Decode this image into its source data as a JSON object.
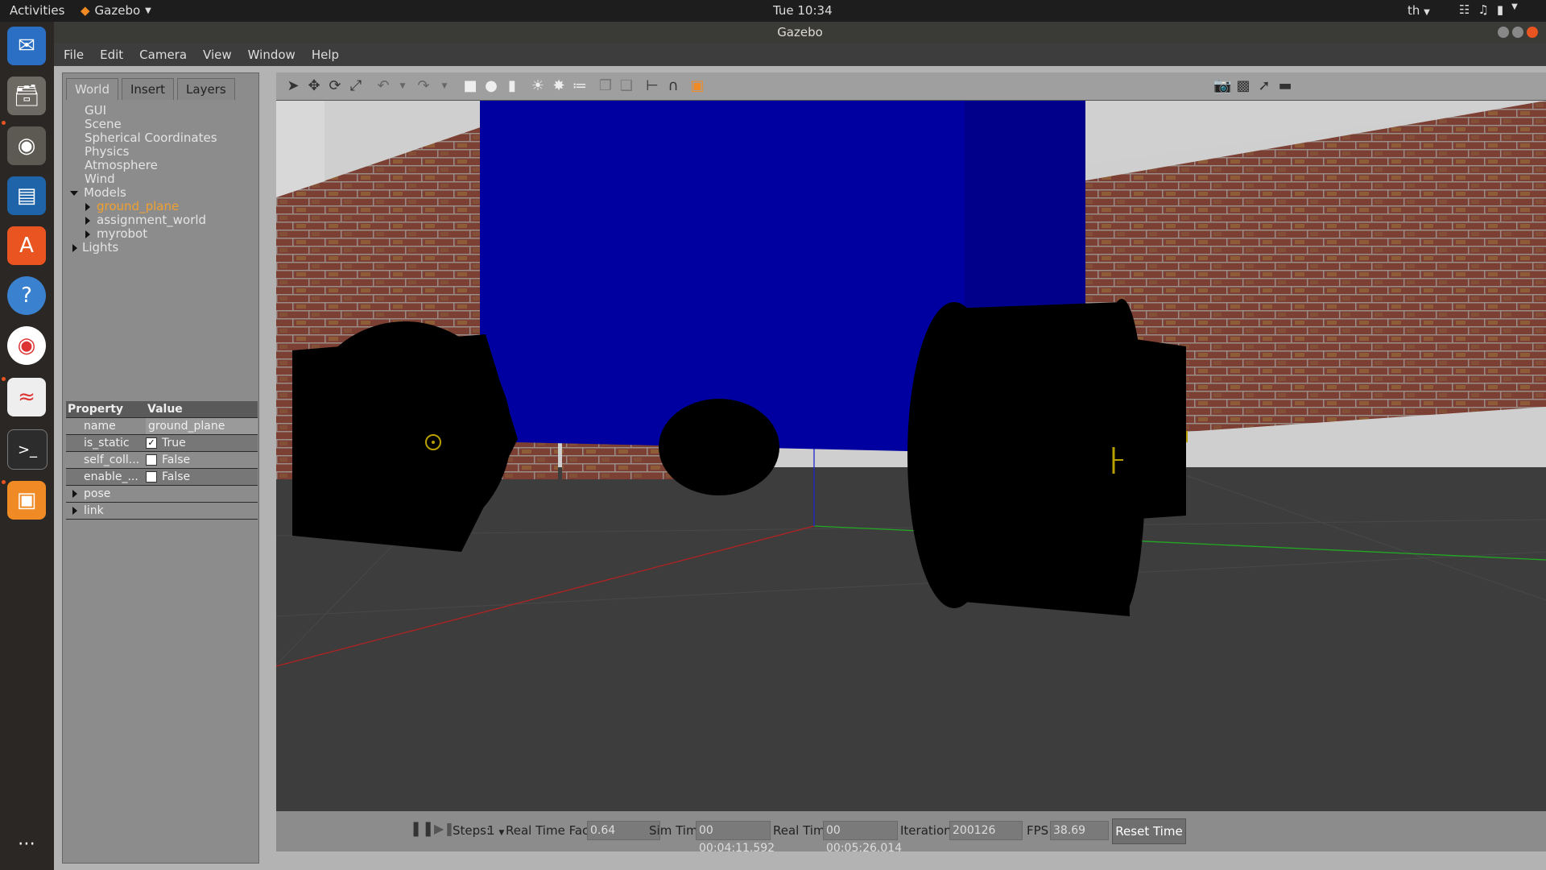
{
  "topbar": {
    "activities": "Activities",
    "app_name": "Gazebo",
    "clock": "Tue 10:34",
    "lang": "th"
  },
  "window": {
    "title": "Gazebo"
  },
  "menu": [
    "File",
    "Edit",
    "Camera",
    "View",
    "Window",
    "Help"
  ],
  "tabs": [
    "World",
    "Insert",
    "Layers"
  ],
  "tree": {
    "gui": "GUI",
    "scene": "Scene",
    "spherical": "Spherical Coordinates",
    "physics": "Physics",
    "atmosphere": "Atmosphere",
    "wind": "Wind",
    "models": "Models",
    "ground_plane": "ground_plane",
    "assignment_world": "assignment_world",
    "myrobot": "myrobot",
    "lights": "Lights"
  },
  "props": {
    "h_property": "Property",
    "h_value": "Value",
    "name_k": "name",
    "name_v": "ground_plane",
    "static_k": "is_static",
    "static_v": "True",
    "selfcoll_k": "self_coll...",
    "selfcoll_v": "False",
    "enable_k": "enable_...",
    "enable_v": "False",
    "pose": "pose",
    "link": "link"
  },
  "status": {
    "steps_label": "Steps:",
    "steps_value": "1",
    "rtf_label": "Real Time Factor:",
    "rtf_value": "0.64",
    "sim_label": "Sim Time:",
    "sim_value": "00 00:04:11.592",
    "real_label": "Real Time:",
    "real_value": "00 00:05:26.014",
    "iter_label": "Iterations:",
    "iter_value": "200126",
    "fps_label": "FPS:",
    "fps_value": "38.69",
    "reset": "Reset Time"
  },
  "colors": {
    "accent_orange": "#f08a24",
    "box_blue": "#0000a0",
    "selected_text": "#f0a030"
  }
}
